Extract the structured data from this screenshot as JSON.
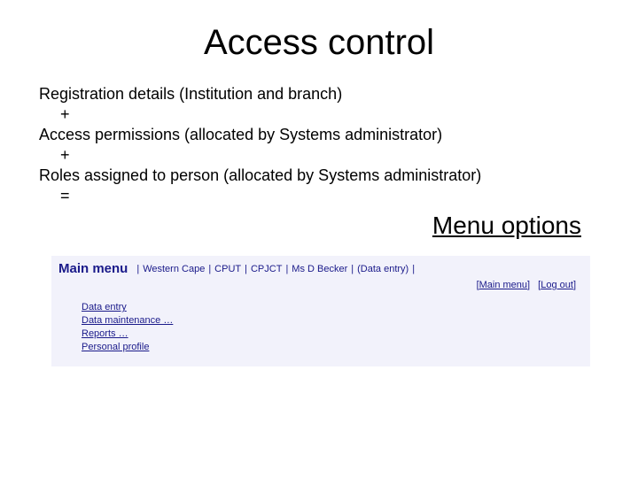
{
  "title": "Access control",
  "body": {
    "line1": "Registration details (Institution and branch)",
    "op1": "+",
    "line2": "Access permissions (allocated by Systems administrator)",
    "op2": "+",
    "line3": "Roles assigned to person (allocated by Systems administrator)",
    "op3": "="
  },
  "menu_options_label": "Menu options",
  "menu": {
    "main_label": "Main menu",
    "crumbs": [
      "Western Cape",
      "CPUT",
      "CPJCT",
      "Ms D Becker",
      "(Data entry)"
    ],
    "links": {
      "main_menu": "Main menu",
      "log_out": "Log out"
    },
    "items": [
      "Data entry",
      "Data maintenance …",
      "Reports …",
      "Personal profile"
    ]
  }
}
